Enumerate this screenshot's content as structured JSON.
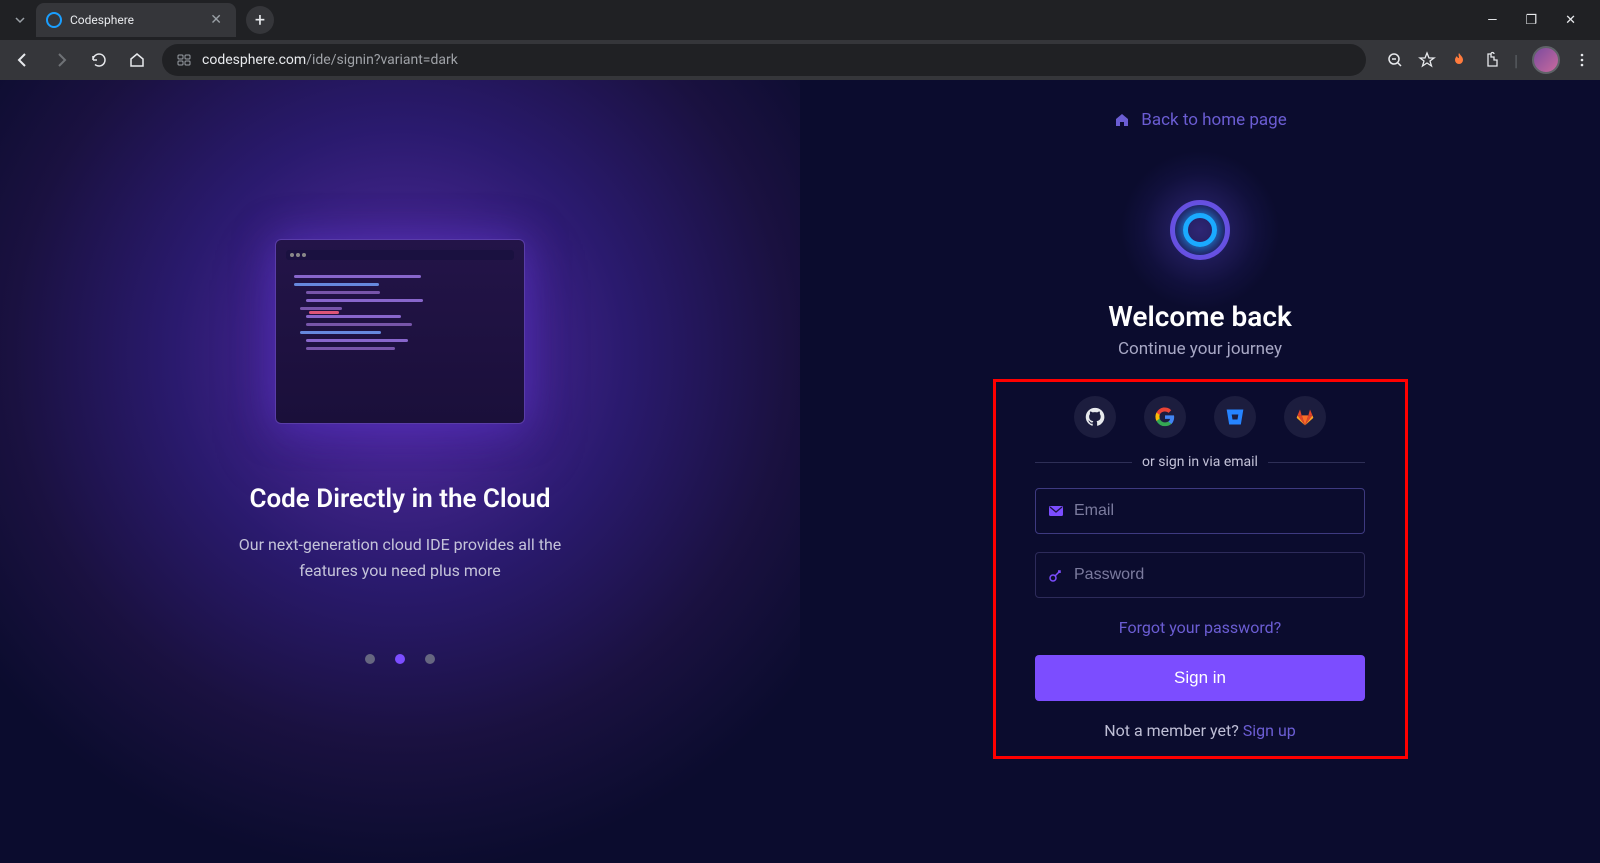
{
  "browser": {
    "tab_title": "Codesphere",
    "url_domain": "codesphere.com",
    "url_path": "/ide/signin?variant=dark"
  },
  "left": {
    "title": "Code Directly in the Cloud",
    "subtitle": "Our next-generation cloud IDE provides all the features you need plus more",
    "active_dot": 1,
    "dot_count": 3
  },
  "right": {
    "back_link": "Back to home page",
    "welcome_title": "Welcome back",
    "welcome_subtitle": "Continue your journey",
    "divider_text": "or sign in via email",
    "email_placeholder": "Email",
    "password_placeholder": "Password",
    "forgot_link": "Forgot your password?",
    "signin_label": "Sign in",
    "signup_prompt": "Not a member yet? ",
    "signup_link": "Sign up",
    "social": [
      "github",
      "google",
      "bitbucket",
      "gitlab"
    ]
  },
  "colors": {
    "accent": "#7c4dff",
    "link": "#6b5dd3",
    "highlight_border": "#ff0000"
  }
}
